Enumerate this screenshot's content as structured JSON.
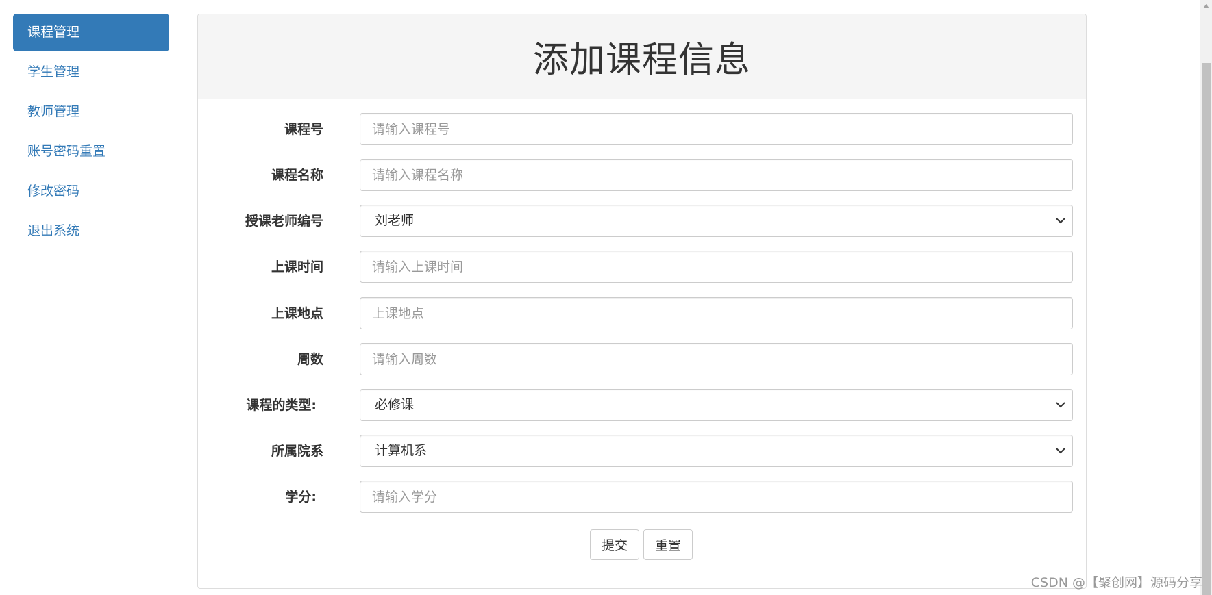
{
  "sidebar": {
    "items": [
      {
        "label": "课程管理",
        "active": true
      },
      {
        "label": "学生管理"
      },
      {
        "label": "教师管理"
      },
      {
        "label": "账号密码重置"
      },
      {
        "label": "修改密码"
      },
      {
        "label": "退出系统"
      }
    ]
  },
  "panel": {
    "title": "添加课程信息"
  },
  "form": {
    "course_no": {
      "label": "课程号",
      "placeholder": "请输入课程号"
    },
    "course_name": {
      "label": "课程名称",
      "placeholder": "请输入课程名称"
    },
    "teacher_no": {
      "label": "授课老师编号",
      "selected": "刘老师"
    },
    "class_time": {
      "label": "上课时间",
      "placeholder": "请输入上课时间"
    },
    "class_place": {
      "label": "上课地点",
      "placeholder": "上课地点"
    },
    "weeks": {
      "label": "周数",
      "placeholder": "请输入周数"
    },
    "course_type": {
      "label": "课程的类型:",
      "selected": "必修课"
    },
    "department": {
      "label": "所属院系",
      "selected": "计算机系"
    },
    "credit": {
      "label": "学分:",
      "placeholder": "请输入学分"
    },
    "submit_label": "提交",
    "reset_label": "重置"
  },
  "watermark": "CSDN @【聚创网】源码分享",
  "colors": {
    "accent": "#337ab7",
    "panel_heading_bg": "#f5f5f5",
    "border": "#cccccc"
  },
  "icons": {
    "select_arrow": "chevron-down-icon",
    "scroll_up": "arrow-up-icon"
  }
}
